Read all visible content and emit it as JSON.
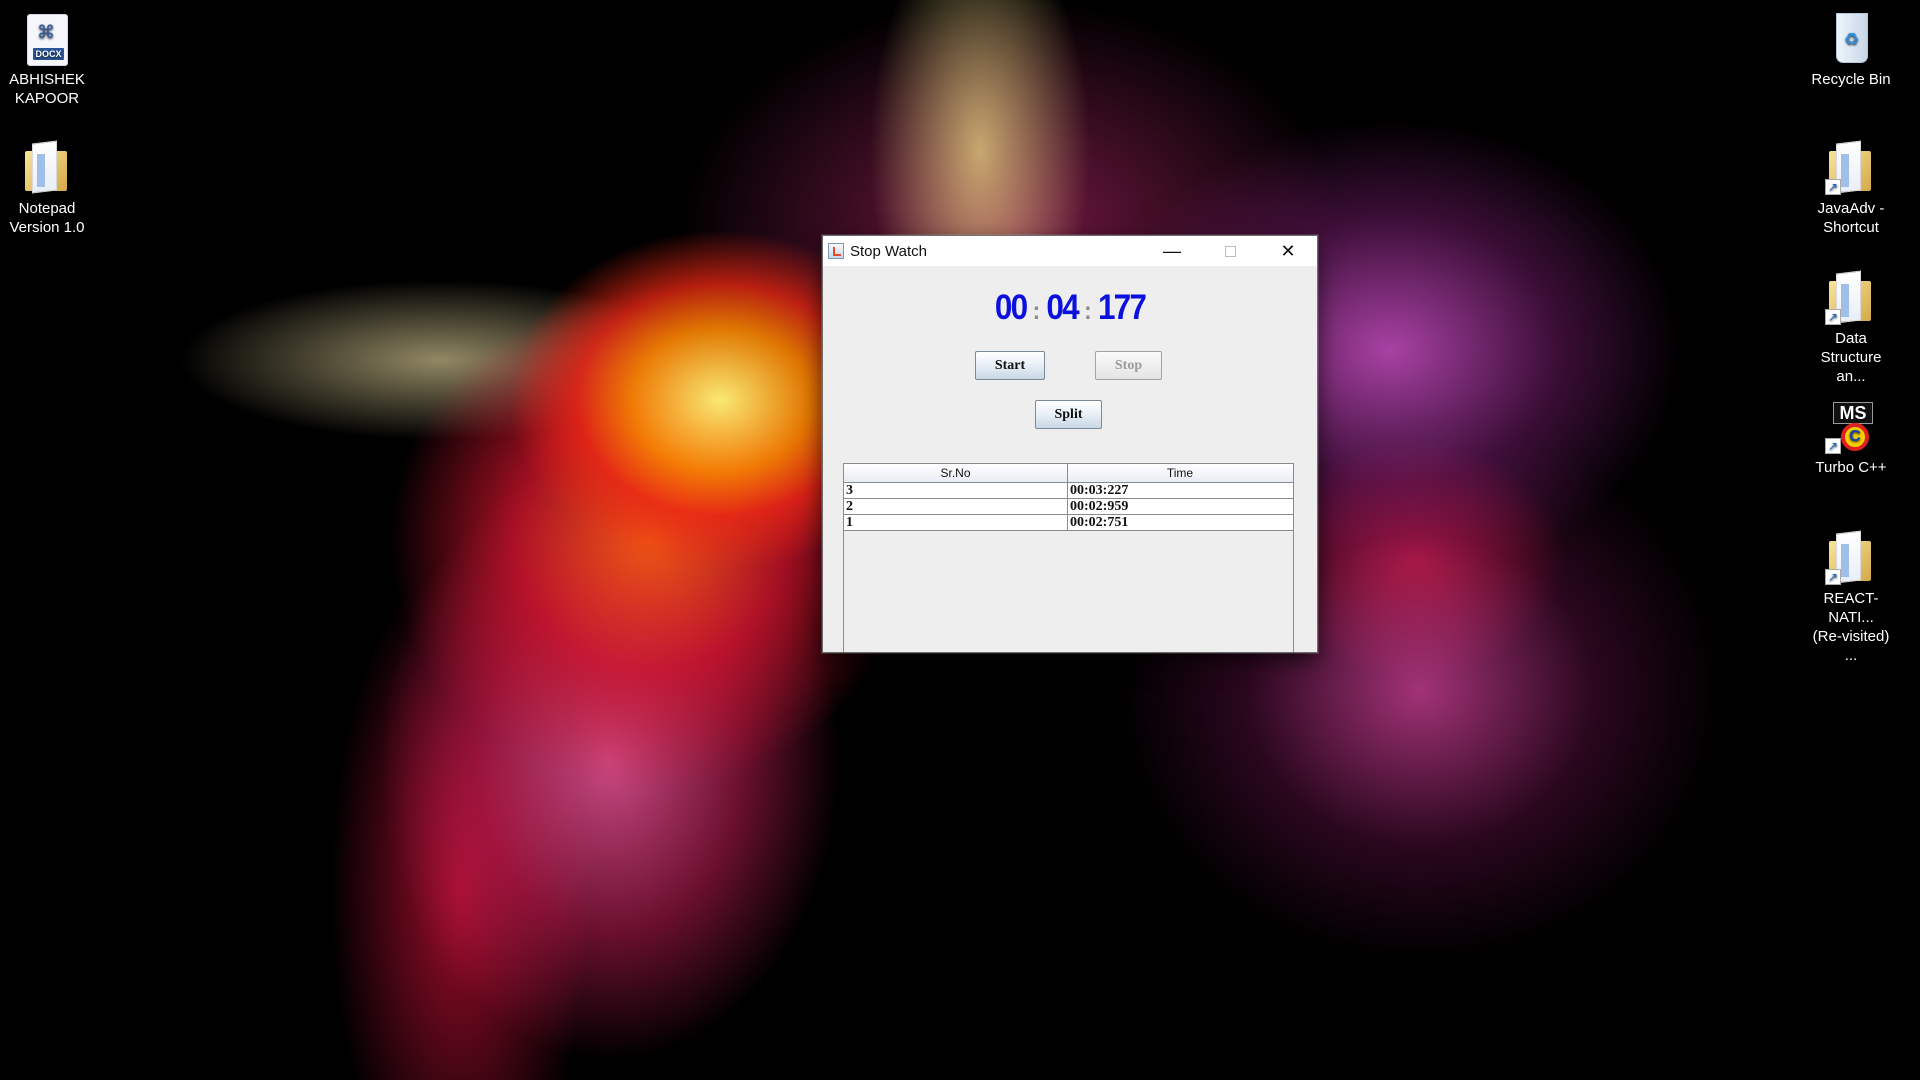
{
  "desktop": {
    "icons": [
      {
        "label": "ABHISHEK\nKAPOOR",
        "icon": "docx-file-icon",
        "badge": "DOCX"
      },
      {
        "label": "Notepad\nVersion 1.0",
        "icon": "folder-icon"
      },
      {
        "label": "Recycle Bin",
        "icon": "recycle-bin-icon"
      },
      {
        "label": "JavaAdv -\nShortcut",
        "icon": "folder-shortcut-icon"
      },
      {
        "label": "Data\nStructure an...",
        "icon": "folder-shortcut-icon"
      },
      {
        "label": "Turbo C++",
        "icon": "turbo-cpp-icon",
        "brand": "MS"
      },
      {
        "label": "REACT-NATI...\n(Re-visited) ...",
        "icon": "folder-shortcut-icon"
      }
    ]
  },
  "window": {
    "title": "Stop Watch",
    "controls": {
      "minimize": "—",
      "maximize": "",
      "close": "✕"
    }
  },
  "stopwatch": {
    "minutes": "00",
    "separator_1": ":",
    "seconds": "04",
    "separator_2": ":",
    "milliseconds": "177"
  },
  "buttons": {
    "start": "Start",
    "stop": "Stop",
    "split": "Split"
  },
  "table": {
    "headers": [
      "Sr.No",
      "Time"
    ],
    "rows": [
      [
        "3",
        "00:03:227"
      ],
      [
        "2",
        "00:02:959"
      ],
      [
        "1",
        "00:02:751"
      ]
    ]
  },
  "colors": {
    "timer": "#0b10de",
    "separator": "#8b8b8b",
    "window_bg": "#eeeeee"
  }
}
